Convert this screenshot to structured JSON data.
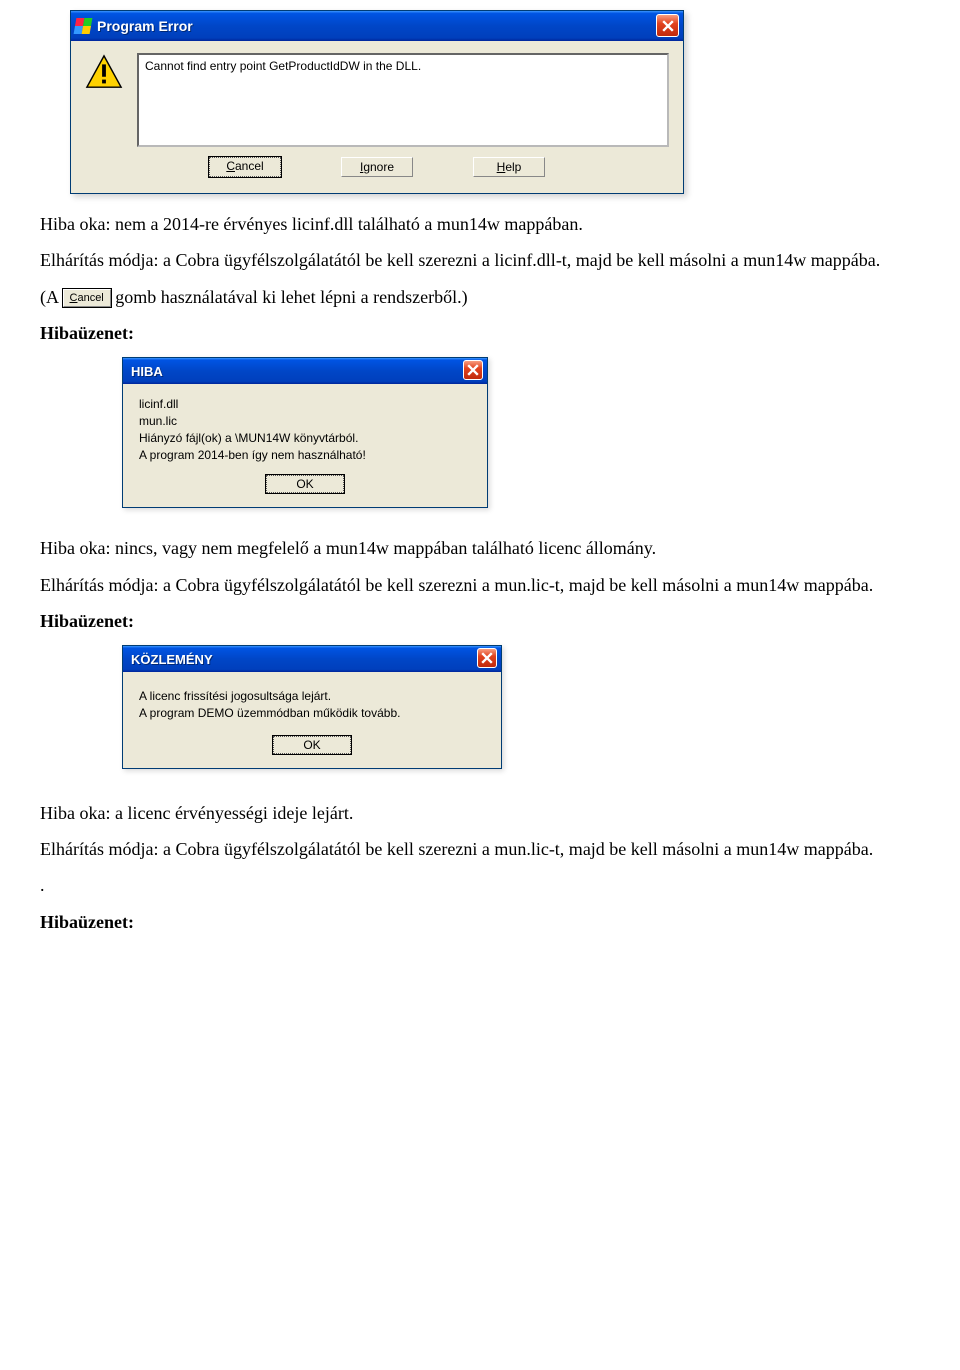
{
  "dialog1": {
    "title": "Program Error",
    "message": "Cannot find entry point GetProductIdDW in the DLL.",
    "buttons": {
      "cancel": "Cancel",
      "ignore": "Ignore",
      "help": "Help"
    }
  },
  "paragraphs": {
    "p1": "Hiba oka: nem a 2014-re érvényes licinf.dll található a mun14w mappában.",
    "p2": "Elhárítás módja: a Cobra ügyfélszolgálatától be kell szerezni a licinf.dll-t, majd be kell másolni a mun14w mappába.",
    "p3_pre": "(A ",
    "p3_btn": "Cancel",
    "p3_post": " gomb használatával ki lehet lépni a rendszerből.)",
    "h1": "Hibaüzenet:",
    "p4": "Hiba oka: nincs, vagy nem megfelelő a mun14w mappában található licenc állomány.",
    "p5": "Elhárítás módja: a Cobra ügyfélszolgálatától be kell szerezni a mun.lic-t, majd be kell másolni a mun14w mappába.",
    "h2": "Hibaüzenet:",
    "p6": "Hiba oka: a licenc érvényességi ideje lejárt.",
    "p7": "Elhárítás módja: a Cobra ügyfélszolgálatától be kell szerezni a mun.lic-t, majd be kell másolni a mun14w mappába.",
    "p8": ".",
    "h3": "Hibaüzenet:"
  },
  "dialog2": {
    "title": "HIBA",
    "lines": {
      "l1": "licinf.dll",
      "l2": "mun.lic",
      "l3": "Hiányzó fájl(ok) a \\MUN14W könyvtárból.",
      "l4": "A program 2014-ben így nem használható!"
    },
    "ok": "OK"
  },
  "dialog3": {
    "title": "KÖZLEMÉNY",
    "lines": {
      "l1": "A licenc frissítési jogosultsága lejárt.",
      "l2": "A program DEMO üzemmódban működik tovább."
    },
    "ok": "OK"
  }
}
